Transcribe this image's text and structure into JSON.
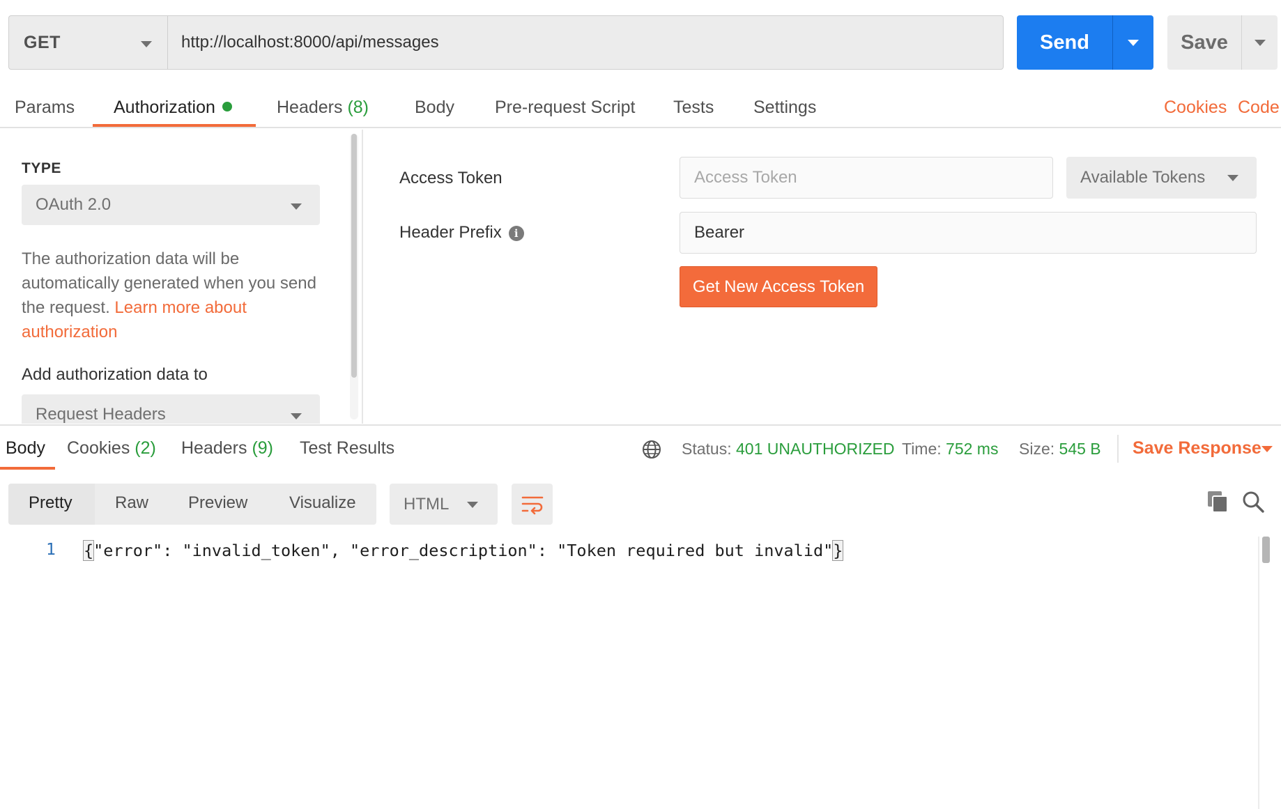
{
  "request": {
    "method": "GET",
    "url": "http://localhost:8000/api/messages",
    "send_label": "Send",
    "save_label": "Save"
  },
  "request_tabs": {
    "params": "Params",
    "authorization": "Authorization",
    "headers": "Headers",
    "headers_count": "(8)",
    "body": "Body",
    "prerequest": "Pre-request Script",
    "tests": "Tests",
    "settings": "Settings",
    "cookies_link": "Cookies",
    "code_link": "Code"
  },
  "auth": {
    "type_label": "TYPE",
    "type_value": "OAuth 2.0",
    "description": "The authorization data will be automatically generated when you send the request. ",
    "learn_more": "Learn more about authorization",
    "add_to_label": "Add authorization data to",
    "add_to_value": "Request Headers",
    "access_token_label": "Access Token",
    "access_token_placeholder": "Access Token",
    "available_tokens": "Available Tokens",
    "header_prefix_label": "Header Prefix",
    "header_prefix_value": "Bearer",
    "get_token_button": "Get New Access Token"
  },
  "response": {
    "tabs": {
      "body": "Body",
      "cookies": "Cookies",
      "cookies_count": "(2)",
      "headers": "Headers",
      "headers_count": "(9)",
      "test_results": "Test Results"
    },
    "status_label": "Status:",
    "status_value": "401 UNAUTHORIZED",
    "time_label": "Time:",
    "time_value": "752 ms",
    "size_label": "Size:",
    "size_value": "545 B",
    "save_response": "Save Response",
    "views": [
      "Pretty",
      "Raw",
      "Preview",
      "Visualize"
    ],
    "format": "HTML",
    "line_number": "1",
    "code_open": "{",
    "code_body": "\"error\": \"invalid_token\", \"error_description\": \"Token required but invalid\"",
    "code_close": "}"
  },
  "colors": {
    "accent_orange": "#f26b3a",
    "send_blue": "#1c7df0",
    "status_green": "#2a9d3c"
  }
}
